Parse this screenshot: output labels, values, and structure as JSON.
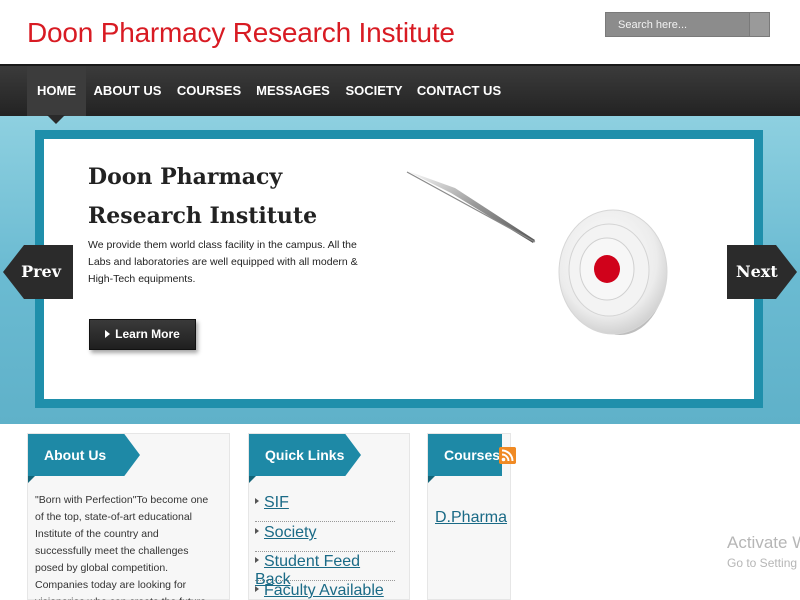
{
  "header": {
    "site_title": "Doon Pharmacy Research Institute",
    "search_placeholder": "Search here..."
  },
  "nav": {
    "items": [
      {
        "label": "HOME",
        "active": true
      },
      {
        "label": "ABOUT US",
        "active": false
      },
      {
        "label": "COURSES",
        "active": false
      },
      {
        "label": "MESSAGES",
        "active": false
      },
      {
        "label": "SOCIETY",
        "active": false
      },
      {
        "label": "CONTACT US",
        "active": false
      }
    ]
  },
  "slider": {
    "title": "Doon Pharmacy Research Institute",
    "text": "We provide them world class facility in the campus. All the Labs and laboratories are well equipped with all modern & High-Tech equipments.",
    "learn_more_label": "Learn More",
    "prev_label": "Prev",
    "next_label": "Next"
  },
  "about": {
    "heading": "About Us",
    "text": "\"Born with Perfection\"To become one of the top, state-of-art educational Institute of the country and successfully meet the challenges posed by global competition. Companies today are looking for visionaries who can create the future,"
  },
  "quick_links": {
    "heading": "Quick Links",
    "items": [
      "SIF",
      "Society",
      "Student Feed Back",
      "Faculty Available"
    ]
  },
  "courses": {
    "heading": "Courses",
    "items": [
      "D.Pharma"
    ]
  },
  "watermark": {
    "line1": "Activate W",
    "line2": "Go to Setting"
  },
  "colors": {
    "title_red": "#d81b23",
    "accent_teal": "#1e89a6",
    "nav_dark": "#2b2b2b",
    "slider_blue": "#6bbbd2",
    "rss_orange": "#f08a24"
  },
  "icons": {
    "search": "search-icon",
    "rss": "rss-icon",
    "link_arrow": "arrow-right-icon"
  }
}
